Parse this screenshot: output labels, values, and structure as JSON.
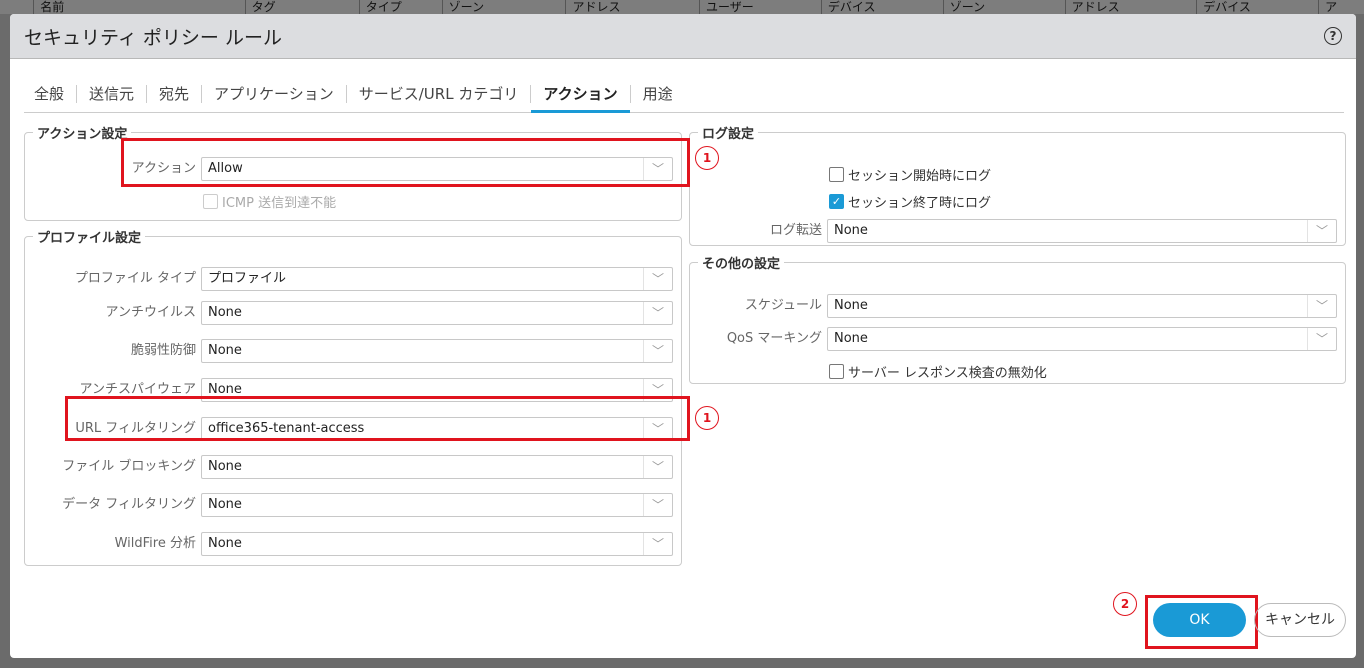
{
  "background_headers": [
    "名前",
    "タグ",
    "タイプ",
    "ゾーン",
    "アドレス",
    "ユーザー",
    "デバイス",
    "ゾーン",
    "アドレス",
    "デバイス",
    "ア"
  ],
  "dialog": {
    "title": "セキュリティ ポリシー ルール",
    "help_icon": "question-circle-icon"
  },
  "tabs": [
    "全般",
    "送信元",
    "宛先",
    "アプリケーション",
    "サービス/URL カテゴリ",
    "アクション",
    "用途"
  ],
  "active_tab": "アクション",
  "action_settings": {
    "legend": "アクション設定",
    "action_label": "アクション",
    "action_value": "Allow",
    "icmp_label": "ICMP 送信到達不能",
    "icmp_checked": false
  },
  "profile_settings": {
    "legend": "プロファイル設定",
    "rows": [
      {
        "label": "プロファイル タイプ",
        "value": "プロファイル"
      },
      {
        "label": "アンチウイルス",
        "value": "None"
      },
      {
        "label": "脆弱性防御",
        "value": "None"
      },
      {
        "label": "アンチスパイウェア",
        "value": "None"
      },
      {
        "label": "URL フィルタリング",
        "value": "office365-tenant-access"
      },
      {
        "label": "ファイル ブロッキング",
        "value": "None"
      },
      {
        "label": "データ フィルタリング",
        "value": "None"
      },
      {
        "label": "WildFire 分析",
        "value": "None"
      }
    ]
  },
  "log_settings": {
    "legend": "ログ設定",
    "log_start_label": "セッション開始時にログ",
    "log_start_checked": false,
    "log_end_label": "セッション終了時にログ",
    "log_end_checked": true,
    "forward_label": "ログ転送",
    "forward_value": "None"
  },
  "other_settings": {
    "legend": "その他の設定",
    "schedule_label": "スケジュール",
    "schedule_value": "None",
    "qos_label": "QoS マーキング",
    "qos_value": "None",
    "disable_srv_label": "サーバー レスポンス検査の無効化",
    "disable_srv_checked": false
  },
  "annotations": {
    "step1": "1",
    "step2": "2",
    "color": "#e0141e"
  },
  "buttons": {
    "ok": "OK",
    "cancel": "キャンセル"
  },
  "colors": {
    "accent": "#1a9ad6"
  }
}
